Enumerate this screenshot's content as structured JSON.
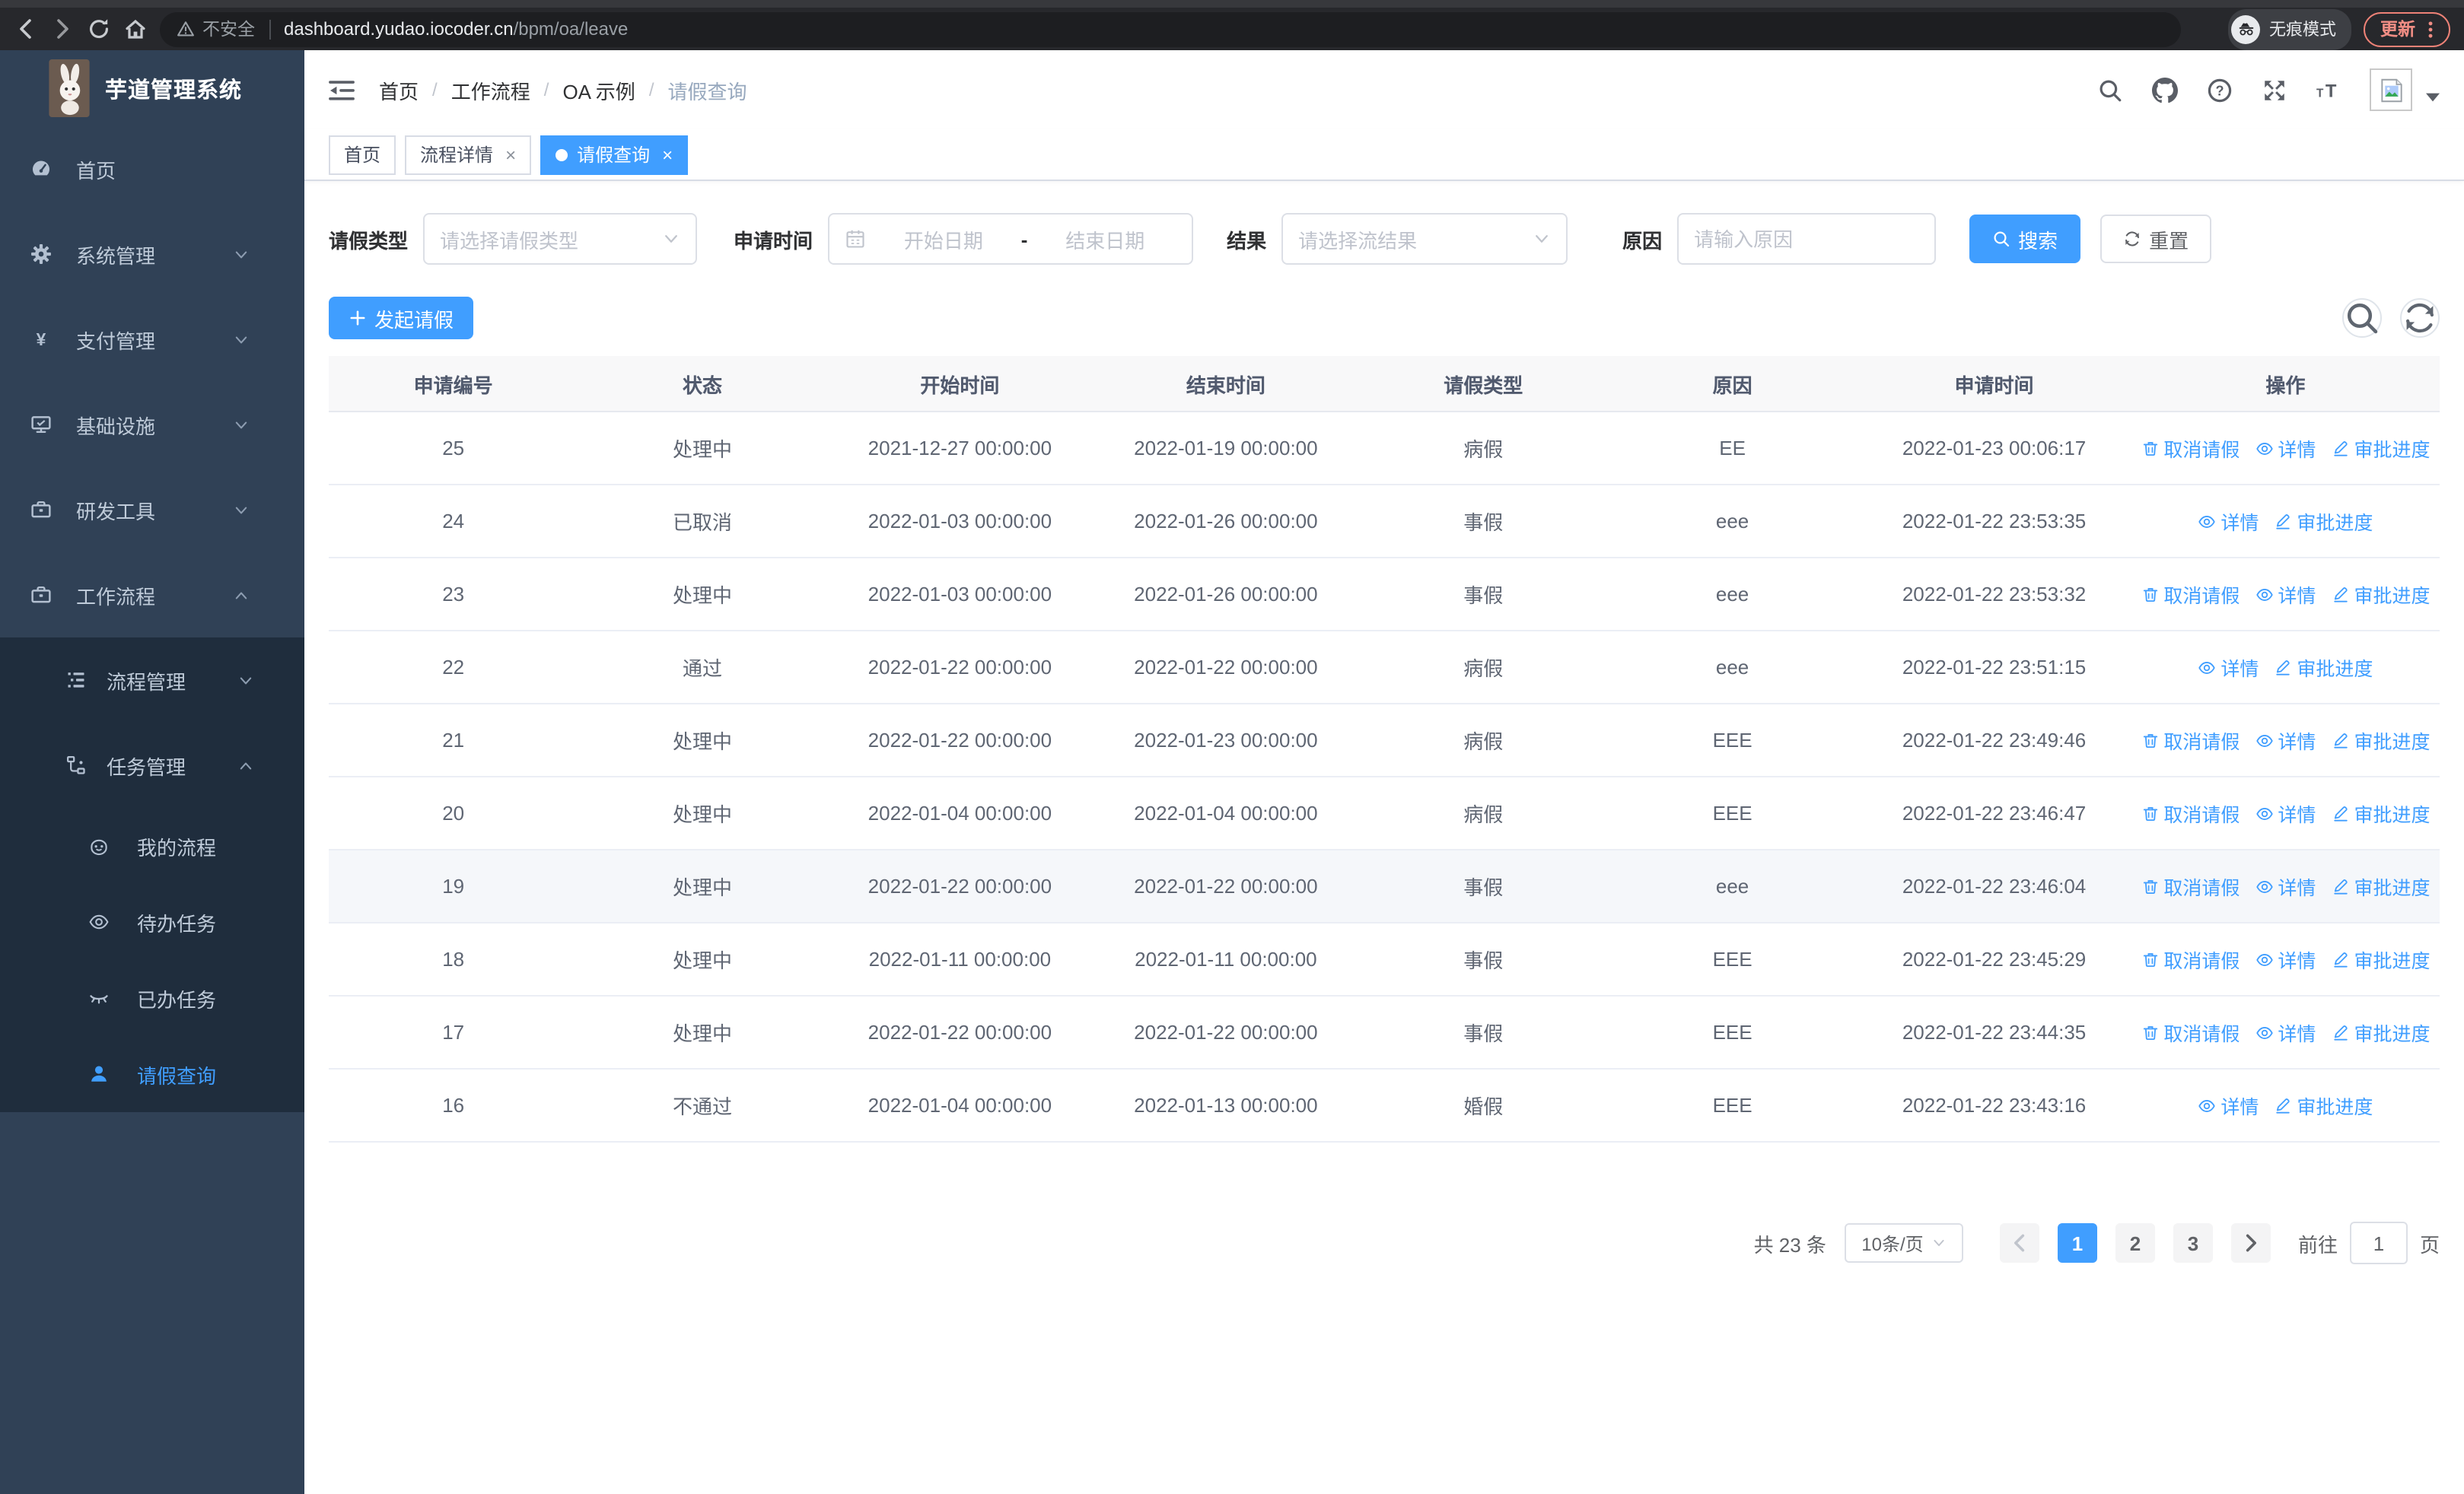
{
  "browser": {
    "security_label": "不安全",
    "url_host": "dashboard.yudao.iocoder.cn",
    "url_path": "/bpm/oa/leave",
    "incognito_label": "无痕模式",
    "update_label": "更新"
  },
  "sidebar": {
    "logo_title": "芋道管理系统",
    "menu": [
      {
        "key": "home",
        "icon": "dashboard-icon",
        "label": "首页",
        "level": 1,
        "chevron": "",
        "active": false
      },
      {
        "key": "system",
        "icon": "gear-icon",
        "label": "系统管理",
        "level": 1,
        "chevron": "down",
        "active": false
      },
      {
        "key": "payment",
        "icon": "yen-icon",
        "label": "支付管理",
        "level": 1,
        "chevron": "down",
        "active": false
      },
      {
        "key": "infrastructure",
        "icon": "monitor-icon",
        "label": "基础设施",
        "level": 1,
        "chevron": "down",
        "active": false
      },
      {
        "key": "devtools",
        "icon": "toolbox-icon",
        "label": "研发工具",
        "level": 1,
        "chevron": "down",
        "active": false
      },
      {
        "key": "workflow",
        "icon": "briefcase-icon",
        "label": "工作流程",
        "level": 1,
        "chevron": "up",
        "active": false
      },
      {
        "key": "process-mgmt",
        "icon": "flow-list-icon",
        "label": "流程管理",
        "level": 2,
        "chevron": "down",
        "active": false
      },
      {
        "key": "task-mgmt",
        "icon": "task-tree-icon",
        "label": "任务管理",
        "level": 2,
        "chevron": "up",
        "active": false
      },
      {
        "key": "my-process",
        "icon": "robot-icon",
        "label": "我的流程",
        "level": 3,
        "chevron": "",
        "active": false
      },
      {
        "key": "todo-tasks",
        "icon": "eye-open-icon",
        "label": "待办任务",
        "level": 3,
        "chevron": "",
        "active": false
      },
      {
        "key": "done-tasks",
        "icon": "eye-closed-icon",
        "label": "已办任务",
        "level": 3,
        "chevron": "",
        "active": false
      },
      {
        "key": "leave-query",
        "icon": "user-icon",
        "label": "请假查询",
        "level": 3,
        "chevron": "",
        "active": true
      }
    ]
  },
  "header": {
    "icons": [
      "search-icon",
      "github-icon",
      "help-icon",
      "fullscreen-icon",
      "font-size-icon"
    ]
  },
  "breadcrumb": {
    "separator": "/",
    "items": [
      "首页",
      "工作流程",
      "OA 示例",
      "请假查询"
    ]
  },
  "tabs": {
    "close_glyph": "×",
    "items": [
      {
        "key": "home",
        "label": "首页",
        "closable": false,
        "active": false
      },
      {
        "key": "process-detail",
        "label": "流程详情",
        "closable": true,
        "active": false
      },
      {
        "key": "leave-query",
        "label": "请假查询",
        "closable": true,
        "active": true
      }
    ]
  },
  "filters": {
    "leave_type_label": "请假类型",
    "leave_type_placeholder": "请选择请假类型",
    "apply_time_label": "申请时间",
    "date_start_placeholder": "开始日期",
    "date_separator": "-",
    "date_end_placeholder": "结束日期",
    "result_label": "结果",
    "result_placeholder": "请选择流结果",
    "reason_label": "原因",
    "reason_placeholder": "请输入原因",
    "search_label": "搜索",
    "reset_label": "重置"
  },
  "toolbar": {
    "create_label": "发起请假"
  },
  "table": {
    "columns": [
      "申请编号",
      "状态",
      "开始时间",
      "结束时间",
      "请假类型",
      "原因",
      "申请时间",
      "操作"
    ],
    "action_labels": {
      "cancel": "取消请假",
      "detail": "详情",
      "progress": "审批进度"
    },
    "rows": [
      {
        "id": "25",
        "status": "处理中",
        "start_time": "2021-12-27 00:00:00",
        "end_time": "2022-01-19 00:00:00",
        "leave_type": "病假",
        "reason": "EE",
        "apply_time": "2022-01-23 00:06:17",
        "cancelable": true,
        "highlight": false
      },
      {
        "id": "24",
        "status": "已取消",
        "start_time": "2022-01-03 00:00:00",
        "end_time": "2022-01-26 00:00:00",
        "leave_type": "事假",
        "reason": "eee",
        "apply_time": "2022-01-22 23:53:35",
        "cancelable": false,
        "highlight": false
      },
      {
        "id": "23",
        "status": "处理中",
        "start_time": "2022-01-03 00:00:00",
        "end_time": "2022-01-26 00:00:00",
        "leave_type": "事假",
        "reason": "eee",
        "apply_time": "2022-01-22 23:53:32",
        "cancelable": true,
        "highlight": false
      },
      {
        "id": "22",
        "status": "通过",
        "start_time": "2022-01-22 00:00:00",
        "end_time": "2022-01-22 00:00:00",
        "leave_type": "病假",
        "reason": "eee",
        "apply_time": "2022-01-22 23:51:15",
        "cancelable": false,
        "highlight": false
      },
      {
        "id": "21",
        "status": "处理中",
        "start_time": "2022-01-22 00:00:00",
        "end_time": "2022-01-23 00:00:00",
        "leave_type": "病假",
        "reason": "EEE",
        "apply_time": "2022-01-22 23:49:46",
        "cancelable": true,
        "highlight": false
      },
      {
        "id": "20",
        "status": "处理中",
        "start_time": "2022-01-04 00:00:00",
        "end_time": "2022-01-04 00:00:00",
        "leave_type": "病假",
        "reason": "EEE",
        "apply_time": "2022-01-22 23:46:47",
        "cancelable": true,
        "highlight": false
      },
      {
        "id": "19",
        "status": "处理中",
        "start_time": "2022-01-22 00:00:00",
        "end_time": "2022-01-22 00:00:00",
        "leave_type": "事假",
        "reason": "eee",
        "apply_time": "2022-01-22 23:46:04",
        "cancelable": true,
        "highlight": true
      },
      {
        "id": "18",
        "status": "处理中",
        "start_time": "2022-01-11 00:00:00",
        "end_time": "2022-01-11 00:00:00",
        "leave_type": "事假",
        "reason": "EEE",
        "apply_time": "2022-01-22 23:45:29",
        "cancelable": true,
        "highlight": false
      },
      {
        "id": "17",
        "status": "处理中",
        "start_time": "2022-01-22 00:00:00",
        "end_time": "2022-01-22 00:00:00",
        "leave_type": "事假",
        "reason": "EEE",
        "apply_time": "2022-01-22 23:44:35",
        "cancelable": true,
        "highlight": false
      },
      {
        "id": "16",
        "status": "不通过",
        "start_time": "2022-01-04 00:00:00",
        "end_time": "2022-01-13 00:00:00",
        "leave_type": "婚假",
        "reason": "EEE",
        "apply_time": "2022-01-22 23:43:16",
        "cancelable": false,
        "highlight": false
      }
    ]
  },
  "pagination": {
    "total_label": "共 23 条",
    "page_size_label": "10条/页",
    "pages": [
      {
        "label": "1",
        "active": true
      },
      {
        "label": "2",
        "active": false
      },
      {
        "label": "3",
        "active": false
      }
    ],
    "goto_label": "前往",
    "goto_value": "1",
    "page_unit_label": "页"
  },
  "colors": {
    "accent": "#409EFF",
    "sidebar_bg": "#304156",
    "submenu_bg": "#1f2d3d",
    "chrome_bg": "#27282c",
    "update_accent": "#f08d84",
    "table_border": "#ebeef5",
    "table_header_bg": "#f8f8f9",
    "row_highlight": "#f5f7fa"
  }
}
